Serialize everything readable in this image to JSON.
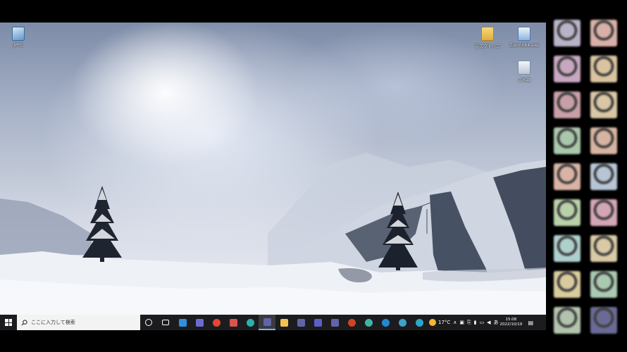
{
  "desktop": {
    "icons": [
      {
        "label": "JPPC",
        "name": "jppc-shortcut"
      },
      {
        "label": "デスクトップ",
        "name": "desktop-folder"
      },
      {
        "label": "Zoomit64.exe",
        "name": "zoomit-exe"
      },
      {
        "label": "ごみ箱",
        "name": "recycle-bin"
      }
    ]
  },
  "taskbar": {
    "search_placeholder": "ここに入力して検索",
    "apps": [
      {
        "name": "cortana-icon",
        "color": "#ffffff"
      },
      {
        "name": "task-view-icon",
        "color": "#ffffff"
      },
      {
        "name": "vscode-icon",
        "color": "#2f8fe0"
      },
      {
        "name": "visual-studio-icon",
        "color": "#6b6bd0"
      },
      {
        "name": "chrome-icon",
        "color": "#e84335"
      },
      {
        "name": "pin-app-icon",
        "color": "#d9534f"
      },
      {
        "name": "edge-icon",
        "color": "#29b1a8"
      },
      {
        "name": "teams-icon",
        "color": "#6264a7"
      },
      {
        "name": "explorer-icon",
        "color": "#f2c14e"
      },
      {
        "name": "teams-icon-2",
        "color": "#6264a7"
      },
      {
        "name": "teams-icon-3",
        "color": "#5b5fc7"
      },
      {
        "name": "teams-icon-4",
        "color": "#6264a7"
      },
      {
        "name": "powerpoint-icon",
        "color": "#d04423"
      },
      {
        "name": "edge-dev-icon",
        "color": "#3fb6a5"
      },
      {
        "name": "edge-beta-icon",
        "color": "#1f8ad1"
      },
      {
        "name": "edge-canary-icon",
        "color": "#3fa2c8"
      },
      {
        "name": "app-icon",
        "color": "#2aa7c9"
      }
    ],
    "weather": {
      "temperature": "17°C"
    },
    "tray_ime": "あ",
    "clock": {
      "time": "15:08",
      "date": "2022/10/19"
    }
  },
  "sidebar": {
    "avatars": [
      "#b9b3c7",
      "#d8b0a8",
      "#c8a7c0",
      "#d9c3a0",
      "#c99fa7",
      "#d8c6a4",
      "#a9c7ab",
      "#d7b3a1",
      "#d9b3a4",
      "#b6c4d6",
      "#b9d1a9",
      "#d3a6b6",
      "#aed0cd",
      "#d9c9a4",
      "#d9cb9c",
      "#a9c9b1",
      "#b2c3ad",
      "#6a6a96"
    ]
  }
}
